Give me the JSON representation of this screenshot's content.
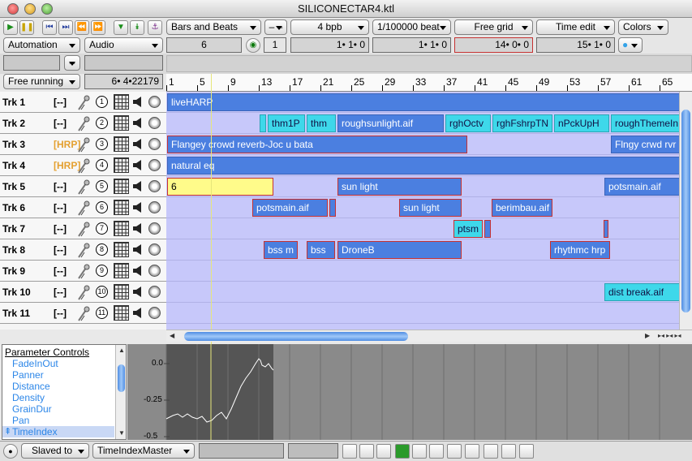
{
  "window": {
    "title": "SILICONECTAR4.ktl"
  },
  "transport": {
    "buttons": [
      "play",
      "pause",
      "to-start",
      "to-end",
      "rewind",
      "fast-forward",
      "down-arrow",
      "down-double-arrow",
      "anchor"
    ],
    "time_format": "Bars and Beats",
    "dash_label": "– –",
    "bpb": "4 bpb",
    "resolution": "1/100000 beat",
    "grid": "Free grid",
    "edit_mode": "Time edit",
    "colors": "Colors"
  },
  "row2": {
    "automation": "Automation",
    "audio": "Audio",
    "beats_field": "6",
    "one_field": "1",
    "pos1": "1• 1•    0",
    "pos2": "1• 1•    0",
    "pos3": "14• 0•    0",
    "pos4": "15• 1•    0"
  },
  "row3": {
    "minus_label": "–"
  },
  "sync": {
    "mode": "Free running",
    "position": "6• 4•22179"
  },
  "ruler": {
    "marks": [
      "1",
      "5",
      "9",
      "13",
      "17",
      "21",
      "25",
      "29",
      "33",
      "37",
      "41",
      "45",
      "49",
      "53",
      "57",
      "61",
      "65"
    ]
  },
  "tracks": [
    {
      "name": "Trk 1",
      "flag": "[--]",
      "num": "1"
    },
    {
      "name": "Trk 2",
      "flag": "[--]",
      "num": "2"
    },
    {
      "name": "Trk 3",
      "flag": "[HRP]",
      "num": "3"
    },
    {
      "name": "Trk 4",
      "flag": "[HRP]",
      "num": "4"
    },
    {
      "name": "Trk 5",
      "flag": "[--]",
      "num": "5"
    },
    {
      "name": "Trk 6",
      "flag": "[--]",
      "num": "6"
    },
    {
      "name": "Trk 7",
      "flag": "[--]",
      "num": "7"
    },
    {
      "name": "Trk 8",
      "flag": "[--]",
      "num": "8"
    },
    {
      "name": "Trk 9",
      "flag": "[--]",
      "num": "9"
    },
    {
      "name": "Trk 10",
      "flag": "[--]",
      "num": "10"
    },
    {
      "name": "Trk 11",
      "flag": "[--]",
      "num": "11"
    }
  ],
  "clips": {
    "t1": [
      "liveHARP"
    ],
    "t2": [
      "",
      "thm1P",
      "thm",
      "roughsunlight.aif",
      "rghOctv",
      "rghFshrpTN",
      "nPckUpH",
      "roughThemeIn"
    ],
    "t3": [
      "Flangey crowd reverb-Joc u bata",
      "Flngy crwd rvr"
    ],
    "t4": [
      "natural eq"
    ],
    "t5": [
      "6",
      "sun light",
      "potsmain.aif"
    ],
    "t6": [
      "potsmain.aif",
      "",
      "sun light",
      "berimbau.aif"
    ],
    "t7": [
      "ptsm",
      "",
      ""
    ],
    "t8": [
      "bss m",
      "bss",
      "DroneB",
      "rhythmc hrp"
    ],
    "t10": [
      "dist break.aif"
    ]
  },
  "params": {
    "header": "Parameter Controls",
    "items": [
      "FadeInOut",
      "Panner",
      "Distance",
      "Density",
      "GrainDur",
      "Pan",
      "TimeIndex"
    ],
    "selected": "TimeIndex"
  },
  "plot": {
    "y_labels": [
      "0.0",
      "-0.25",
      "-0.5"
    ]
  },
  "bottom": {
    "slaved": "Slaved to",
    "master": "TimeIndexMaster"
  }
}
